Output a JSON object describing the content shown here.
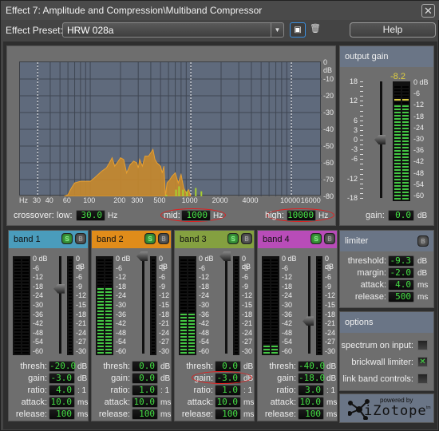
{
  "window": {
    "title": "Effect 7: Amplitude and Compression\\Multiband Compressor",
    "close_icon": "close-x-icon"
  },
  "preset": {
    "label": "Effect Preset:",
    "value": "HRW 028a",
    "save_icon": "floppy-disk-icon",
    "delete_icon": "trash-icon",
    "help_label": "Help"
  },
  "spectrum": {
    "db_ticks": [
      "0 dB",
      "-10",
      "-20",
      "-30",
      "-40",
      "-50",
      "-60",
      "-70",
      "-80"
    ],
    "hz_ticks": [
      "Hz",
      "30",
      "40",
      "60",
      "100",
      "200",
      "300",
      "500",
      "1000",
      "2000",
      "4000",
      "10000",
      "16000"
    ],
    "crossover_label": "crossover:",
    "low_label": "low:",
    "low_value": "30.0",
    "mid_label": "mid:",
    "mid_value": "1000",
    "high_label": "high:",
    "high_value": "10000",
    "unit_hz": "Hz",
    "colors": {
      "main": "#c88a2c",
      "accent": "#a8d030"
    }
  },
  "output_gain": {
    "title": "output gain",
    "peak_readout": "-8.2",
    "slider_ticks": [
      "18",
      "12",
      "6",
      "3",
      "0",
      "-3",
      "-6",
      "-12",
      "-18"
    ],
    "meter_ticks": [
      "0 dB",
      "-6",
      "-12",
      "-18",
      "-24",
      "-30",
      "-36",
      "-42",
      "-48",
      "-54",
      "-60"
    ],
    "gain_label": "gain:",
    "gain_value": "0.0",
    "gain_unit": "dB",
    "slider_value_db": 0,
    "meter_level_db": -10
  },
  "bands": [
    {
      "name": "band 1",
      "color": "#4a9cbc",
      "solo": "S",
      "bypass": "B",
      "thresh": "-20.0",
      "gain": "-3.0",
      "ratio": "4.0",
      "attack": "10.0",
      "release": "100",
      "slider_db": -20,
      "meter_db": -60,
      "peak_db": -60
    },
    {
      "name": "band 2",
      "color": "#e08c1a",
      "solo": "S",
      "bypass": "B",
      "thresh": "0.0",
      "gain": "0.0",
      "ratio": "1.0",
      "attack": "10.0",
      "release": "100",
      "slider_db": 0,
      "meter_db": -19,
      "peak_db": -14
    },
    {
      "name": "band 3",
      "color": "#84a040",
      "solo": "S",
      "bypass": "B",
      "thresh": "0.0",
      "gain": "-3.0",
      "ratio": "1.0",
      "attack": "10.0",
      "release": "100",
      "slider_db": 0,
      "meter_db": -34,
      "peak_db": -34
    },
    {
      "name": "band 4",
      "color": "#b84cb8",
      "solo": "S",
      "bypass": "B",
      "thresh": "-40.0",
      "gain": "-18.0",
      "ratio": "3.0",
      "attack": "10.0",
      "release": "100",
      "slider_db": -40,
      "meter_db": -55,
      "peak_db": -46
    }
  ],
  "band_labels": {
    "thresh": "thresh:",
    "gain": "gain:",
    "ratio": "ratio:",
    "attack": "attack:",
    "release": "release:",
    "u_db": "dB",
    "u_ratio": ": 1",
    "u_ms": "ms",
    "meter_ticks": [
      "0 dB",
      "-6",
      "-12",
      "-18",
      "-24",
      "-30",
      "-36",
      "-42",
      "-48",
      "-54",
      "-60"
    ],
    "gr_ticks": [
      "0 dB",
      "-3",
      "-6",
      "-9",
      "-12",
      "-15",
      "-18",
      "-21",
      "-24",
      "-27",
      "-30"
    ]
  },
  "limiter": {
    "title": "limiter",
    "bypass": "B",
    "threshold_label": "threshold:",
    "threshold": "-9.3",
    "threshold_unit": "dB",
    "margin_label": "margin:",
    "margin": "-2.0",
    "margin_unit": "dB",
    "attack_label": "attack:",
    "attack": "4.0",
    "attack_unit": "ms",
    "release_label": "release:",
    "release": "500",
    "release_unit": "ms"
  },
  "options": {
    "title": "options",
    "items": [
      {
        "label": "spectrum on input:",
        "checked": false,
        "mark": ""
      },
      {
        "label": "brickwall limiter:",
        "checked": true,
        "mark": "✕"
      },
      {
        "label": "link band controls:",
        "checked": false,
        "mark": ""
      }
    ]
  },
  "logo": {
    "powered_by": "powered by",
    "brand": "iZotope",
    "tm": "tm"
  }
}
